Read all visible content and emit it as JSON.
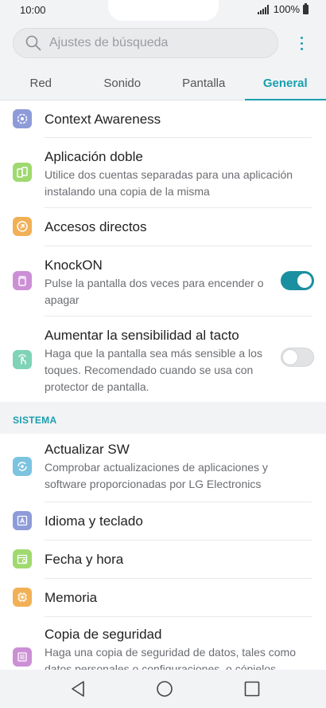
{
  "status": {
    "time": "10:00",
    "battery_text": "100%"
  },
  "search": {
    "placeholder": "Ajustes de búsqueda"
  },
  "tabs": [
    {
      "label": "Red",
      "active": false
    },
    {
      "label": "Sonido",
      "active": false
    },
    {
      "label": "Pantalla",
      "active": false
    },
    {
      "label": "General",
      "active": true
    }
  ],
  "items": {
    "context": {
      "title": "Context Awareness",
      "icon": "context-awareness-icon",
      "color": "#8e9bd9"
    },
    "dual_app": {
      "title": "Aplicación doble",
      "subtitle": "Utilice dos cuentas separadas para una aplicación instalando una copia de la misma",
      "icon": "dual-app-icon",
      "color": "#9fd96f"
    },
    "shortcuts": {
      "title": "Accesos directos",
      "icon": "shortcut-icon",
      "color": "#f2b056"
    },
    "knockon": {
      "title": "KnockON",
      "subtitle": "Pulse la pantalla dos veces para encender o apagar",
      "icon": "knock-icon",
      "color": "#cc8fd6",
      "enabled": true
    },
    "touch": {
      "title": "Aumentar la sensibilidad al tacto",
      "subtitle": "Haga que la pantalla sea más sensible a los toques. Recomendado cuando se usa con protector de pantalla.",
      "icon": "touch-sensitivity-icon",
      "color": "#7fd3b6",
      "enabled": false
    }
  },
  "section": {
    "label": "SISTEMA"
  },
  "system_items": {
    "update": {
      "title": "Actualizar SW",
      "subtitle": "Comprobar actualizaciones de aplicaciones y software proporcionadas por LG Electronics",
      "icon": "update-icon",
      "color": "#7cc3e0"
    },
    "language": {
      "title": "Idioma y teclado",
      "icon": "keyboard-icon",
      "color": "#8e9bd9"
    },
    "datetime": {
      "title": "Fecha y hora",
      "icon": "calendar-icon",
      "color": "#9fd96f"
    },
    "storage": {
      "title": "Memoria",
      "icon": "chip-icon",
      "color": "#f2b056"
    },
    "backup": {
      "title": "Copia de seguridad",
      "subtitle": "Haga una copia de seguridad de datos, tales como datos personales o configuraciones, o cópielos",
      "icon": "backup-icon",
      "color": "#cc8fd6"
    }
  },
  "accent_color": "#1a9fae"
}
